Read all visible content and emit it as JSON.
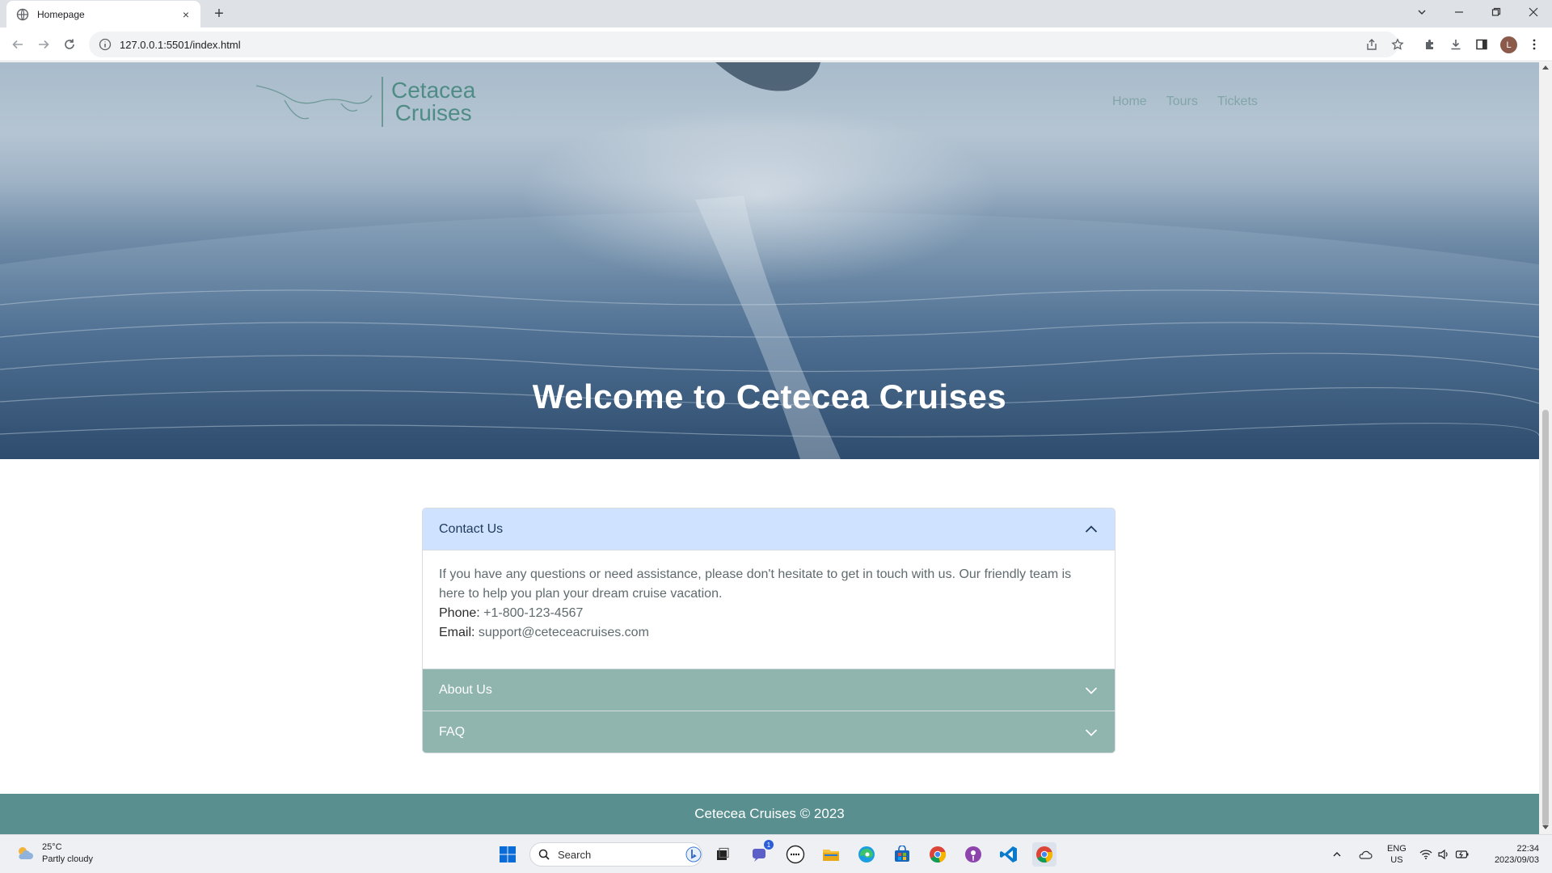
{
  "browser": {
    "tab_title": "Homepage",
    "tab_close": "×",
    "new_tab": "+",
    "url": "127.0.0.1:5501/index.html",
    "profile_initial": "L"
  },
  "site": {
    "brand_line1": "Cetacea",
    "brand_line2": "Cruises",
    "nav": [
      "Home",
      "Tours",
      "Tickets"
    ],
    "hero_title": "Welcome to Cetecea Cruises",
    "accordion": {
      "contact": {
        "title": "Contact Us",
        "body": "If you have any questions or need assistance, please don't hesitate to get in touch with us. Our friendly team is here to help you plan your dream cruise vacation.",
        "phone_label": "Phone:",
        "phone": "+1-800-123-4567",
        "email_label": "Email:",
        "email": "support@ceteceacruises.com"
      },
      "about": {
        "title": "About Us"
      },
      "faq": {
        "title": "FAQ"
      }
    },
    "footer": "Cetecea Cruises © 2023"
  },
  "taskbar": {
    "temp": "25°C",
    "weather": "Partly cloudy",
    "search_placeholder": "Search",
    "lang_line1": "ENG",
    "lang_line2": "US",
    "time": "22:34",
    "date": "2023/09/03",
    "teams_badge": "1"
  },
  "colors": {
    "accordion_open_bg": "#cfe2ff",
    "accordion_closed_bg": "#8fb5ae",
    "footer_bg": "#5a8f8f"
  }
}
